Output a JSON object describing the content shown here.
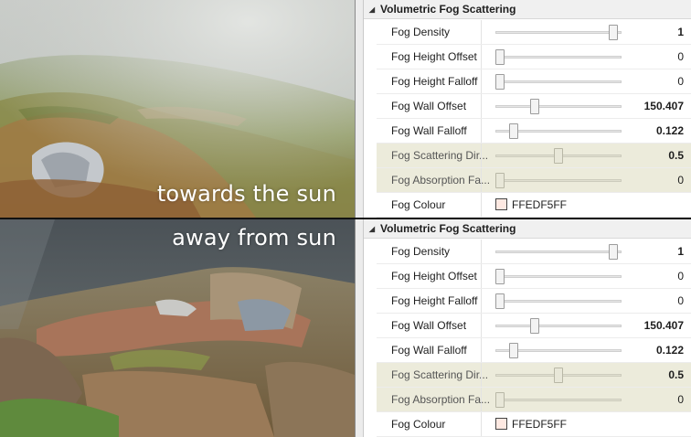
{
  "panels": [
    {
      "scene_label": "towards the sun",
      "title": "Volumetric Fog Scattering",
      "rows": [
        {
          "label": "Fog Density",
          "value": "1",
          "fraction": 0.97,
          "bold": true,
          "dim": false
        },
        {
          "label": "Fog Height Offset",
          "value": "0",
          "fraction": 0.0,
          "bold": false,
          "dim": false
        },
        {
          "label": "Fog Height Falloff",
          "value": "0",
          "fraction": 0.0,
          "bold": false,
          "dim": false
        },
        {
          "label": "Fog Wall Offset",
          "value": "150.407",
          "fraction": 0.3,
          "bold": true,
          "dim": false
        },
        {
          "label": "Fog Wall Falloff",
          "value": "0.122",
          "fraction": 0.12,
          "bold": true,
          "dim": false
        },
        {
          "label": "Fog Scattering Dir...",
          "value": "0.5",
          "fraction": 0.5,
          "bold": true,
          "dim": true
        },
        {
          "label": "Fog Absorption Fa...",
          "value": "0",
          "fraction": 0.0,
          "bold": false,
          "dim": true
        }
      ],
      "colour": {
        "label": "Fog Colour",
        "hex": "FFEDF5FF"
      }
    },
    {
      "scene_label": "away from sun",
      "title": "Volumetric Fog Scattering",
      "rows": [
        {
          "label": "Fog Density",
          "value": "1",
          "fraction": 0.97,
          "bold": true,
          "dim": false
        },
        {
          "label": "Fog Height Offset",
          "value": "0",
          "fraction": 0.0,
          "bold": false,
          "dim": false
        },
        {
          "label": "Fog Height Falloff",
          "value": "0",
          "fraction": 0.0,
          "bold": false,
          "dim": false
        },
        {
          "label": "Fog Wall Offset",
          "value": "150.407",
          "fraction": 0.3,
          "bold": true,
          "dim": false
        },
        {
          "label": "Fog Wall Falloff",
          "value": "0.122",
          "fraction": 0.12,
          "bold": true,
          "dim": false
        },
        {
          "label": "Fog Scattering Dir...",
          "value": "0.5",
          "fraction": 0.5,
          "bold": true,
          "dim": true
        },
        {
          "label": "Fog Absorption Fa...",
          "value": "0",
          "fraction": 0.0,
          "bold": false,
          "dim": true
        }
      ],
      "colour": {
        "label": "Fog Colour",
        "hex": "FFEDF5FF"
      }
    }
  ]
}
